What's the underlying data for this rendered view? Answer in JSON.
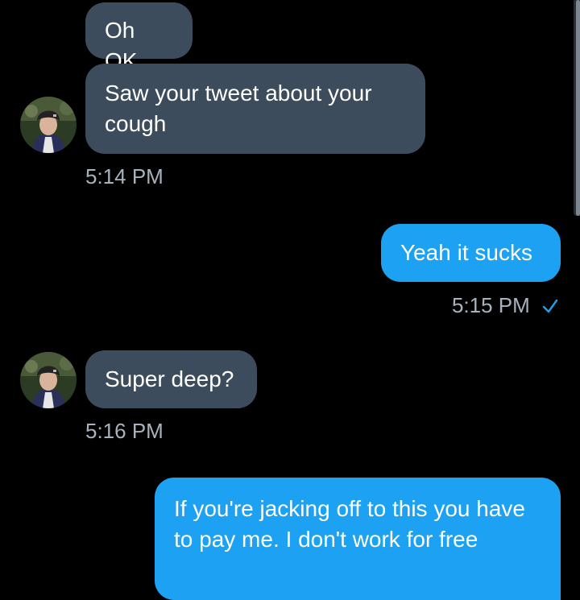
{
  "conversation": {
    "messages": [
      {
        "direction": "incoming",
        "text": "Oh OK"
      },
      {
        "direction": "incoming",
        "text": "Saw your tweet about your cough",
        "time": "5:14 PM"
      },
      {
        "direction": "outgoing",
        "text": "Yeah it sucks",
        "time": "5:15 PM",
        "status_icon": "checkmark-icon"
      },
      {
        "direction": "incoming",
        "text": "Super deep?",
        "time": "5:16 PM"
      },
      {
        "direction": "outgoing",
        "text": "If you're jacking off to this you have to pay me. I don't work for free"
      }
    ]
  },
  "colors": {
    "background": "#000000",
    "incoming_bubble": "#3d4c5c",
    "outgoing_bubble": "#1da1f2",
    "timestamp": "#a7b2bd",
    "checkmark": "#1da1f2"
  },
  "icons": {
    "avatar": "avatar-icon",
    "read_receipt": "checkmark-icon"
  }
}
